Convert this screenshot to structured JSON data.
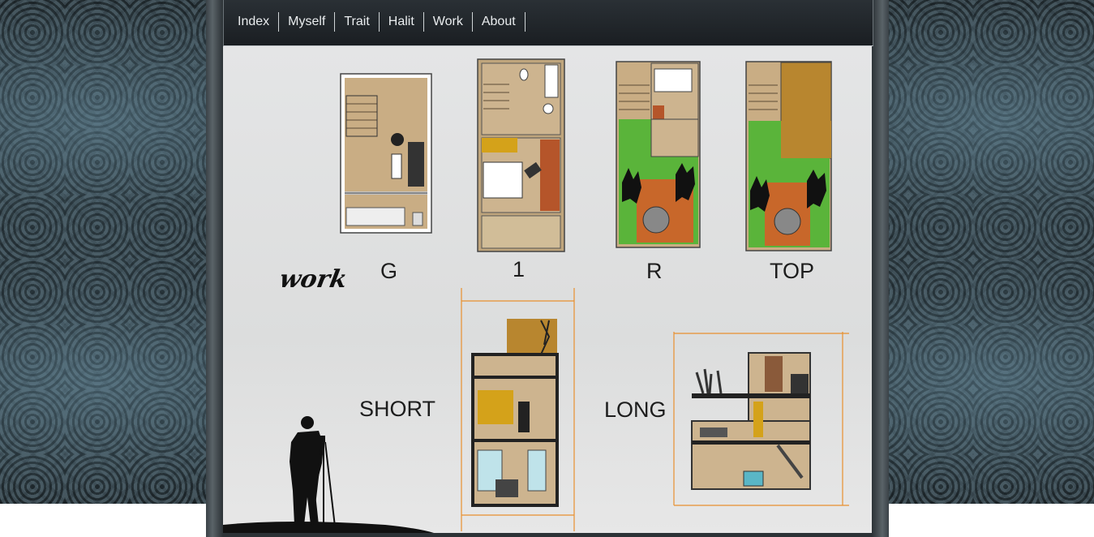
{
  "nav": {
    "items": [
      {
        "label": "Index"
      },
      {
        "label": "Myself"
      },
      {
        "label": "Trait"
      },
      {
        "label": "Halit"
      },
      {
        "label": "Work"
      },
      {
        "label": "About"
      }
    ]
  },
  "poster": {
    "title_script": "work",
    "plan_labels": {
      "ground": "G",
      "first": "1",
      "roof": "R",
      "top": "TOP"
    },
    "section_labels": {
      "short": "SHORT",
      "long": "LONG"
    },
    "colors": {
      "accent_orange": "#e8902f",
      "grass": "#5ab43a",
      "wood": "#c9ad84",
      "brick": "#c8672a"
    }
  }
}
